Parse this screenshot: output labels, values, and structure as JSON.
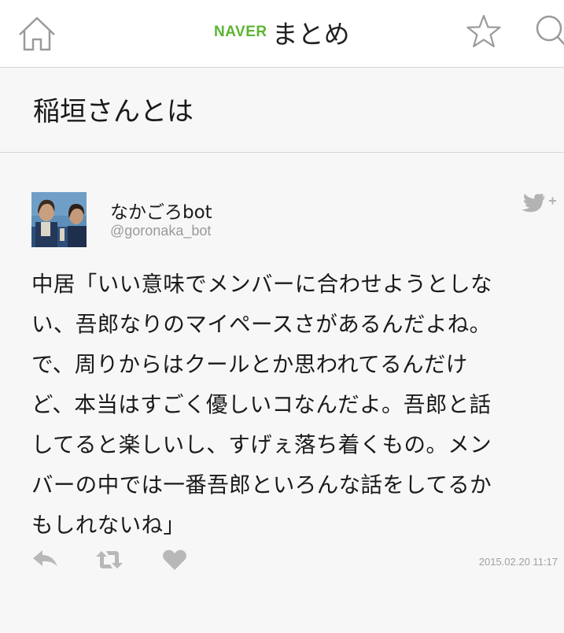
{
  "header": {
    "home_icon": "home-icon",
    "logo_brand": "NAVER",
    "logo_text": "まとめ",
    "favorite_icon": "star-icon",
    "search_icon": "search-icon",
    "brand_color": "#5cb531"
  },
  "page": {
    "title": "稲垣さんとは"
  },
  "tweet": {
    "user_name": "なかごろbot",
    "user_handle": "@goronaka_bot",
    "follow_icon": "twitter-bird-follow-icon",
    "text_lines": [
      "中居「いい意味でメンバーに合わせようとしな",
      "い、吾郎なりのマイペースさがあるんだよね。",
      "で、周りからはクールとか思われてるんだけ",
      "ど、本当はすごく優しいコなんだよ。吾郎と話",
      "してると楽しいし、すげぇ落ち着くもの。メン",
      "バーの中では一番吾郎といろんな話をしてるか",
      "もしれないね」"
    ],
    "actions": {
      "reply_icon": "reply-icon",
      "retweet_icon": "retweet-icon",
      "like_icon": "heart-icon"
    },
    "timestamp": "2015.02.20 11:17"
  }
}
